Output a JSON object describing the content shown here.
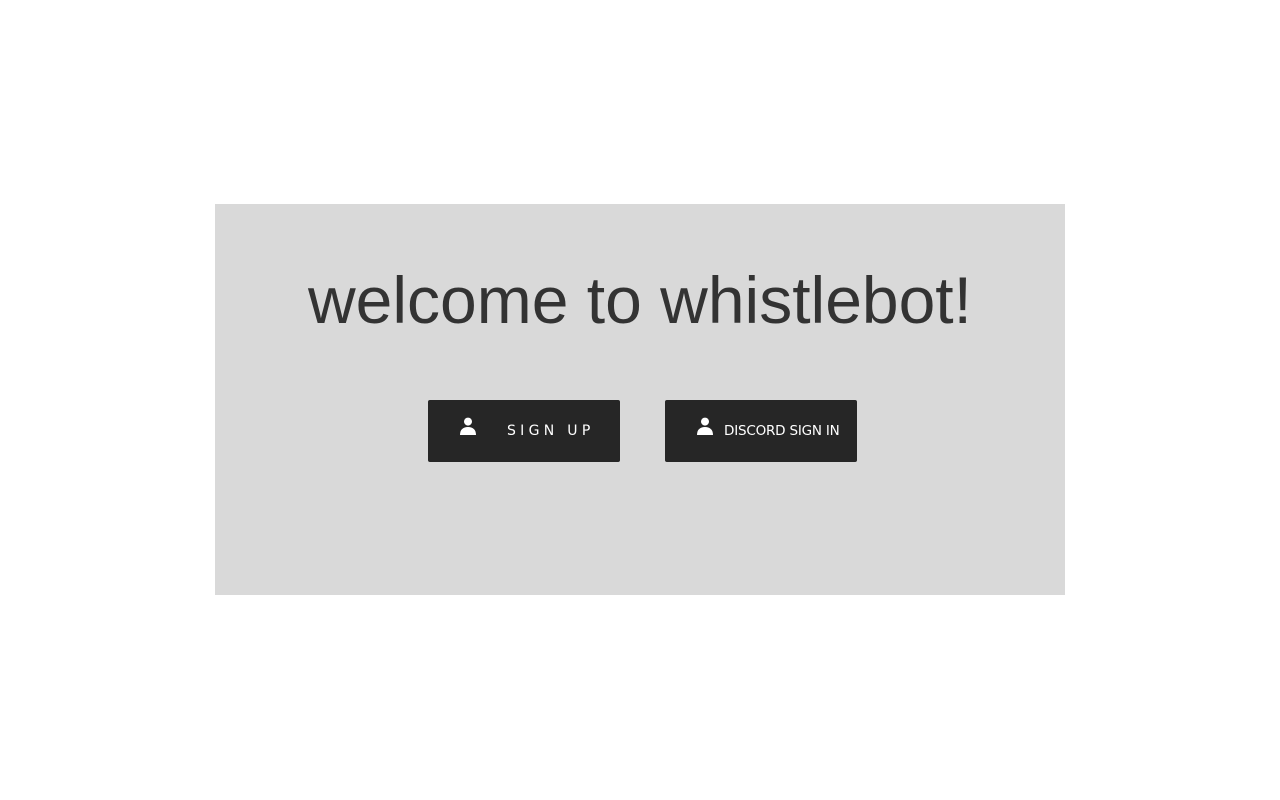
{
  "welcome": {
    "title": "welcome to whistlebot!"
  },
  "buttons": {
    "sign_up": {
      "label": "SIGN UP",
      "icon": "user-icon"
    },
    "discord_sign_in": {
      "label": "DISCORD SIGN IN",
      "icon": "user-icon"
    }
  },
  "colors": {
    "panel_background": "#d9d9d9",
    "button_background": "#262626",
    "title_text": "#333333",
    "button_text": "#ffffff"
  }
}
